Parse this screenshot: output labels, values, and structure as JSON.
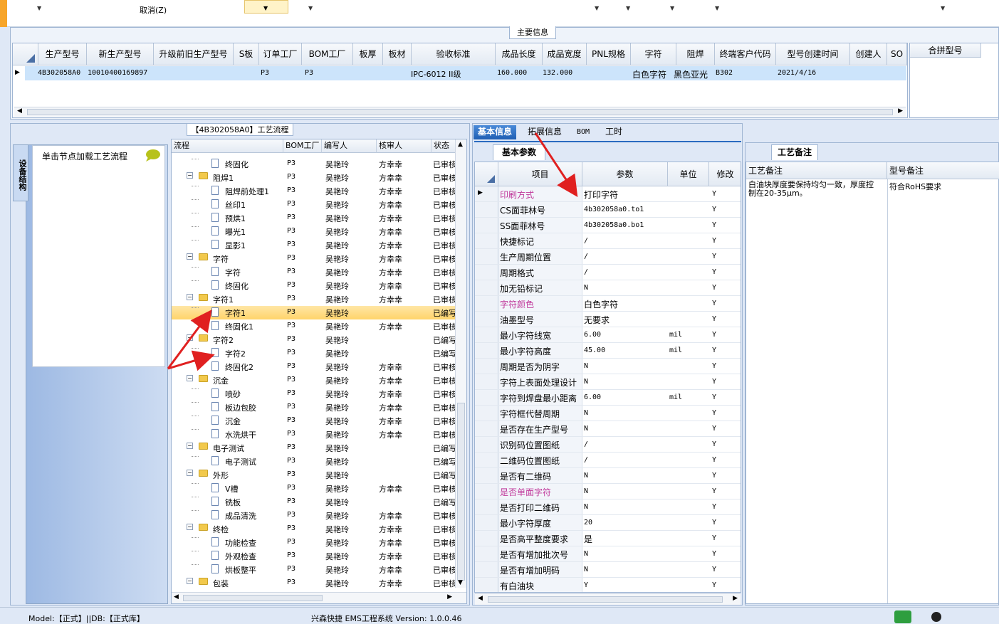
{
  "toolbar": {
    "cancel_label": "取消(Z)"
  },
  "main_info": {
    "panel_title": "主要信息",
    "columns": [
      "生产型号",
      "新生产型号",
      "升级前旧生产型号",
      "S板",
      "订单工厂",
      "BOM工厂",
      "板厚",
      "板材",
      "验收标准",
      "成品长度",
      "成品宽度",
      "PNL规格",
      "字符",
      "阻焊",
      "终端客户代码",
      "型号创建时间",
      "创建人",
      "SO"
    ],
    "row": {
      "model": "4B302058A0",
      "new_model": "10010400169897",
      "order_factory": "P3",
      "bom_factory": "P3",
      "standard": "IPC-6012 II级",
      "length": "160.000",
      "width": "132.000",
      "char": "白色字符",
      "mask": "黑色亚光",
      "customer": "B302",
      "created": "2021/4/16"
    },
    "merge_title": "合拼型号"
  },
  "process": {
    "panel_title": "【4B302058A0】工艺流程",
    "vtab_label": "设备结构",
    "node_hint": "单击节点加载工艺流程",
    "columns": [
      "流程",
      "BOM工厂",
      "编写人",
      "核审人",
      "状态"
    ],
    "rows": [
      {
        "level": 2,
        "type": "doc",
        "name": "终固化",
        "bom": "P3",
        "writer": "吴艳玲",
        "reviewer": "方幸幸",
        "status": "已审核"
      },
      {
        "level": 1,
        "type": "folder",
        "name": "阻焊1",
        "bom": "P3",
        "writer": "吴艳玲",
        "reviewer": "方幸幸",
        "status": "已审核"
      },
      {
        "level": 2,
        "type": "doc",
        "name": "阻焊前处理1",
        "bom": "P3",
        "writer": "吴艳玲",
        "reviewer": "方幸幸",
        "status": "已审核"
      },
      {
        "level": 2,
        "type": "doc",
        "name": "丝印1",
        "bom": "P3",
        "writer": "吴艳玲",
        "reviewer": "方幸幸",
        "status": "已审核"
      },
      {
        "level": 2,
        "type": "doc",
        "name": "预烘1",
        "bom": "P3",
        "writer": "吴艳玲",
        "reviewer": "方幸幸",
        "status": "已审核"
      },
      {
        "level": 2,
        "type": "doc",
        "name": "曝光1",
        "bom": "P3",
        "writer": "吴艳玲",
        "reviewer": "方幸幸",
        "status": "已审核"
      },
      {
        "level": 2,
        "type": "doc",
        "name": "显影1",
        "bom": "P3",
        "writer": "吴艳玲",
        "reviewer": "方幸幸",
        "status": "已审核"
      },
      {
        "level": 1,
        "type": "folder",
        "name": "字符",
        "bom": "P3",
        "writer": "吴艳玲",
        "reviewer": "方幸幸",
        "status": "已审核"
      },
      {
        "level": 2,
        "type": "doc",
        "name": "字符",
        "bom": "P3",
        "writer": "吴艳玲",
        "reviewer": "方幸幸",
        "status": "已审核"
      },
      {
        "level": 2,
        "type": "doc",
        "name": "终固化",
        "bom": "P3",
        "writer": "吴艳玲",
        "reviewer": "方幸幸",
        "status": "已审核"
      },
      {
        "level": 1,
        "type": "folder",
        "name": "字符1",
        "bom": "P3",
        "writer": "吴艳玲",
        "reviewer": "方幸幸",
        "status": "已审核"
      },
      {
        "level": 2,
        "type": "doc",
        "name": "字符1",
        "bom": "P3",
        "writer": "吴艳玲",
        "reviewer": "",
        "status": "已编写",
        "selected": true
      },
      {
        "level": 2,
        "type": "doc",
        "name": "终固化1",
        "bom": "P3",
        "writer": "吴艳玲",
        "reviewer": "方幸幸",
        "status": "已审核"
      },
      {
        "level": 1,
        "type": "folder",
        "name": "字符2",
        "bom": "P3",
        "writer": "吴艳玲",
        "reviewer": "",
        "status": "已编写"
      },
      {
        "level": 2,
        "type": "doc",
        "name": "字符2",
        "bom": "P3",
        "writer": "吴艳玲",
        "reviewer": "",
        "status": "已编写"
      },
      {
        "level": 2,
        "type": "doc",
        "name": "终固化2",
        "bom": "P3",
        "writer": "吴艳玲",
        "reviewer": "方幸幸",
        "status": "已审核"
      },
      {
        "level": 1,
        "type": "folder",
        "name": "沉金",
        "bom": "P3",
        "writer": "吴艳玲",
        "reviewer": "方幸幸",
        "status": "已审核"
      },
      {
        "level": 2,
        "type": "doc",
        "name": "喷砂",
        "bom": "P3",
        "writer": "吴艳玲",
        "reviewer": "方幸幸",
        "status": "已审核"
      },
      {
        "level": 2,
        "type": "doc",
        "name": "板边包胶",
        "bom": "P3",
        "writer": "吴艳玲",
        "reviewer": "方幸幸",
        "status": "已审核"
      },
      {
        "level": 2,
        "type": "doc",
        "name": "沉金",
        "bom": "P3",
        "writer": "吴艳玲",
        "reviewer": "方幸幸",
        "status": "已审核"
      },
      {
        "level": 2,
        "type": "doc",
        "name": "水洗烘干",
        "bom": "P3",
        "writer": "吴艳玲",
        "reviewer": "方幸幸",
        "status": "已审核"
      },
      {
        "level": 1,
        "type": "folder",
        "name": "电子测试",
        "bom": "P3",
        "writer": "吴艳玲",
        "reviewer": "",
        "status": "已编写"
      },
      {
        "level": 2,
        "type": "doc",
        "name": "电子测试",
        "bom": "P3",
        "writer": "吴艳玲",
        "reviewer": "",
        "status": "已编写"
      },
      {
        "level": 1,
        "type": "folder",
        "name": "外形",
        "bom": "P3",
        "writer": "吴艳玲",
        "reviewer": "",
        "status": "已编写"
      },
      {
        "level": 2,
        "type": "doc",
        "name": "V槽",
        "bom": "P3",
        "writer": "吴艳玲",
        "reviewer": "方幸幸",
        "status": "已审核"
      },
      {
        "level": 2,
        "type": "doc",
        "name": "铣板",
        "bom": "P3",
        "writer": "吴艳玲",
        "reviewer": "",
        "status": "已编写"
      },
      {
        "level": 2,
        "type": "doc",
        "name": "成品清洗",
        "bom": "P3",
        "writer": "吴艳玲",
        "reviewer": "方幸幸",
        "status": "已审核"
      },
      {
        "level": 1,
        "type": "folder",
        "name": "终检",
        "bom": "P3",
        "writer": "吴艳玲",
        "reviewer": "方幸幸",
        "status": "已审核"
      },
      {
        "level": 2,
        "type": "doc",
        "name": "功能检查",
        "bom": "P3",
        "writer": "吴艳玲",
        "reviewer": "方幸幸",
        "status": "已审核"
      },
      {
        "level": 2,
        "type": "doc",
        "name": "外观检查",
        "bom": "P3",
        "writer": "吴艳玲",
        "reviewer": "方幸幸",
        "status": "已审核"
      },
      {
        "level": 2,
        "type": "doc",
        "name": "烘板整平",
        "bom": "P3",
        "writer": "吴艳玲",
        "reviewer": "方幸幸",
        "status": "已审核"
      },
      {
        "level": 1,
        "type": "folder",
        "name": "包装",
        "bom": "P3",
        "writer": "吴艳玲",
        "reviewer": "方幸幸",
        "status": "已审核"
      }
    ]
  },
  "detail": {
    "tabs": [
      "基本信息",
      "拓展信息",
      "BOM",
      "工时"
    ],
    "subtab": "基本参数",
    "columns": [
      "项目",
      "参数",
      "单位",
      "修改"
    ],
    "rows": [
      {
        "item": "印刷方式",
        "value": "打印字符",
        "unit": "",
        "mod": "Y",
        "pink": true
      },
      {
        "item": "CS面菲林号",
        "value": "4b302058a0.to1",
        "unit": "",
        "mod": "Y"
      },
      {
        "item": "SS面菲林号",
        "value": "4b302058a0.bo1",
        "unit": "",
        "mod": "Y"
      },
      {
        "item": "快捷标记",
        "value": "/",
        "unit": "",
        "mod": "Y"
      },
      {
        "item": "生产周期位置",
        "value": "/",
        "unit": "",
        "mod": "Y"
      },
      {
        "item": "周期格式",
        "value": "/",
        "unit": "",
        "mod": "Y"
      },
      {
        "item": "加无铅标记",
        "value": "N",
        "unit": "",
        "mod": "Y"
      },
      {
        "item": "字符颜色",
        "value": "白色字符",
        "unit": "",
        "mod": "Y",
        "pink": true
      },
      {
        "item": "油墨型号",
        "value": "无要求",
        "unit": "",
        "mod": "Y"
      },
      {
        "item": "最小字符线宽",
        "value": "6.00",
        "unit": "mil",
        "mod": "Y"
      },
      {
        "item": "最小字符高度",
        "value": "45.00",
        "unit": "mil",
        "mod": "Y"
      },
      {
        "item": "周期是否为阴字",
        "value": "N",
        "unit": "",
        "mod": "Y"
      },
      {
        "item": "字符上表面处理设计",
        "value": "N",
        "unit": "",
        "mod": "Y"
      },
      {
        "item": "字符到焊盘最小距离",
        "value": "6.00",
        "unit": "mil",
        "mod": "Y"
      },
      {
        "item": "字符框代替周期",
        "value": "N",
        "unit": "",
        "mod": "Y"
      },
      {
        "item": "是否存在生产型号",
        "value": "N",
        "unit": "",
        "mod": "Y"
      },
      {
        "item": "识别码位置图纸",
        "value": "/",
        "unit": "",
        "mod": "Y"
      },
      {
        "item": "二维码位置图纸",
        "value": "/",
        "unit": "",
        "mod": "Y"
      },
      {
        "item": "是否有二维码",
        "value": "N",
        "unit": "",
        "mod": "Y"
      },
      {
        "item": "是否单面字符",
        "value": "N",
        "unit": "",
        "mod": "Y",
        "pink": true
      },
      {
        "item": "是否打印二维码",
        "value": "N",
        "unit": "",
        "mod": "Y"
      },
      {
        "item": "最小字符厚度",
        "value": "20",
        "unit": "",
        "mod": "Y"
      },
      {
        "item": "是否高平整度要求",
        "value": "是",
        "unit": "",
        "mod": "Y"
      },
      {
        "item": "是否有增加批次号",
        "value": "N",
        "unit": "",
        "mod": "Y"
      },
      {
        "item": "是否有增加明码",
        "value": "N",
        "unit": "",
        "mod": "Y"
      },
      {
        "item": "有白油块",
        "value": "Y",
        "unit": "",
        "mod": "Y"
      }
    ]
  },
  "remarks": {
    "tab": "工艺备注",
    "col1": "工艺备注",
    "col2": "型号备注",
    "text1": "白油块厚度要保持均匀一致，厚度控制在20-35μm。",
    "text2": "符合RoHS要求"
  },
  "status": {
    "model": "Model:【正式】||DB:【正式库】",
    "system": "兴森快捷 EMS工程系统 Version: 1.0.0.46"
  },
  "colors": {
    "selection": "#cce4fb",
    "tree_selection": "#ffd46a",
    "pink": "#c0399b",
    "arrow": "#e02020"
  }
}
